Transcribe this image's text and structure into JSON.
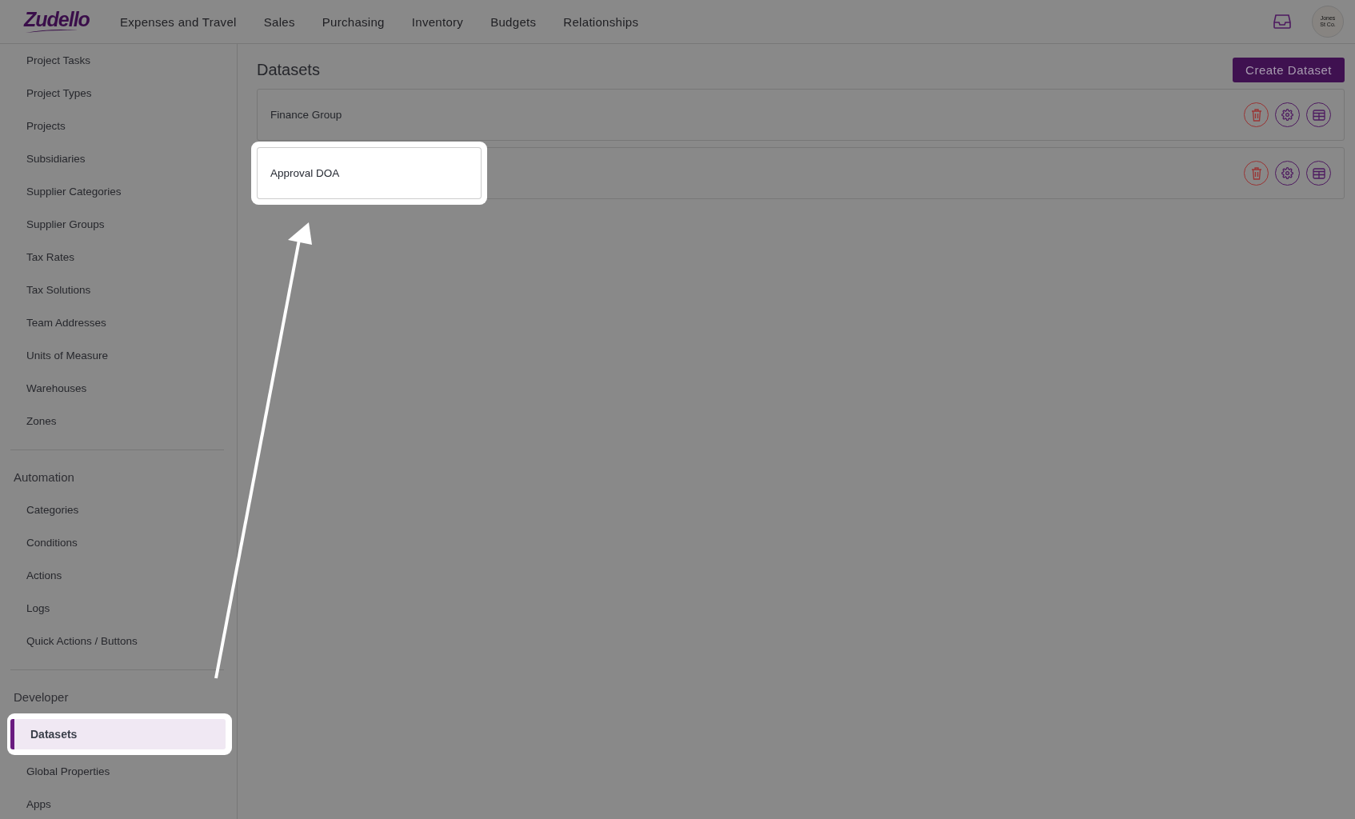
{
  "header": {
    "logo": "Zudello",
    "nav": [
      {
        "label": "Expenses and Travel"
      },
      {
        "label": "Sales"
      },
      {
        "label": "Purchasing"
      },
      {
        "label": "Inventory"
      },
      {
        "label": "Budgets"
      },
      {
        "label": "Relationships"
      }
    ],
    "avatar": "Jones St Co."
  },
  "sidebar": {
    "sections": [
      {
        "items": [
          {
            "label": "Project Tasks",
            "selected": false
          },
          {
            "label": "Project Types",
            "selected": false
          },
          {
            "label": "Projects",
            "selected": false
          },
          {
            "label": "Subsidiaries",
            "selected": false
          },
          {
            "label": "Supplier Categories",
            "selected": false
          },
          {
            "label": "Supplier Groups",
            "selected": false
          },
          {
            "label": "Tax Rates",
            "selected": false
          },
          {
            "label": "Tax Solutions",
            "selected": false
          },
          {
            "label": "Team Addresses",
            "selected": false
          },
          {
            "label": "Units of Measure",
            "selected": false
          },
          {
            "label": "Warehouses",
            "selected": false
          },
          {
            "label": "Zones",
            "selected": false
          }
        ]
      },
      {
        "heading": "Automation",
        "items": [
          {
            "label": "Categories",
            "selected": false
          },
          {
            "label": "Conditions",
            "selected": false
          },
          {
            "label": "Actions",
            "selected": false
          },
          {
            "label": "Logs",
            "selected": false
          },
          {
            "label": "Quick Actions / Buttons",
            "selected": false
          }
        ]
      },
      {
        "heading": "Developer",
        "items": [
          {
            "label": "Datasets",
            "selected": true
          },
          {
            "label": "Global Properties",
            "selected": false
          },
          {
            "label": "Apps",
            "selected": false
          }
        ]
      }
    ]
  },
  "content": {
    "title": "Datasets",
    "create_button": "Create Dataset",
    "rows": [
      {
        "name": "Finance Group",
        "highlighted": false
      },
      {
        "name": "Approval DOA",
        "highlighted": true
      }
    ]
  }
}
